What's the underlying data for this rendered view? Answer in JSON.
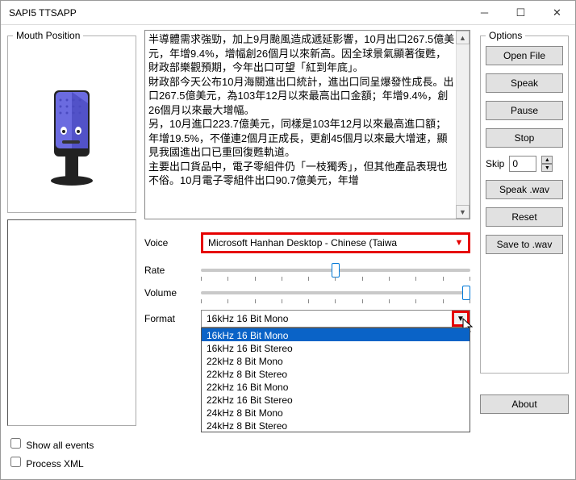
{
  "window": {
    "title": "SAPI5 TTSAPP"
  },
  "mouth": {
    "legend": "Mouth Position"
  },
  "checks": {
    "show_all": "Show all events",
    "process_xml": "Process XML"
  },
  "text_content": [
    "半導體需求強勁，加上9月颱風造成遞延影響，10月出口267.5億美元，年增9.4%，增幅創26個月以來新高。因全球景氣顯著復甦，財政部樂觀預期，今年出口可望「紅到年底」。",
    "財政部今天公布10月海關進出口統計，進出口同呈爆發性成長。出口267.5億美元，為103年12月以來最高出口金額；年增9.4%，創26個月以來最大增幅。",
    "另，10月進口223.7億美元，同樣是103年12月以來最高進口額；年增19.5%，不僅連2個月正成長，更創45個月以來最大增速，顯見我國進出口已重回復甦軌道。",
    "主要出口貨品中，電子零組件仍「一枝獨秀」，但其他產品表現也不俗。10月電子零組件出口90.7億美元，年增"
  ],
  "labels": {
    "voice": "Voice",
    "rate": "Rate",
    "volume": "Volume",
    "format": "Format"
  },
  "voice": {
    "selected": "Microsoft Hanhan Desktop - Chinese (Taiwa"
  },
  "format": {
    "selected": "16kHz 16 Bit Mono",
    "options": [
      "16kHz 16 Bit Mono",
      "16kHz 16 Bit Stereo",
      "22kHz 8 Bit Mono",
      "22kHz 8 Bit Stereo",
      "22kHz 16 Bit Mono",
      "22kHz 16 Bit Stereo",
      "24kHz 8 Bit Mono",
      "24kHz 8 Bit Stereo"
    ],
    "selected_index": 0
  },
  "sliders": {
    "rate_pct": 50,
    "volume_pct": 100
  },
  "options": {
    "legend": "Options",
    "open_file": "Open File",
    "speak": "Speak",
    "pause": "Pause",
    "stop": "Stop",
    "skip_label": "Skip",
    "skip_value": "0",
    "speak_wav": "Speak .wav",
    "reset": "Reset",
    "save_wav": "Save to .wav",
    "about": "About"
  }
}
